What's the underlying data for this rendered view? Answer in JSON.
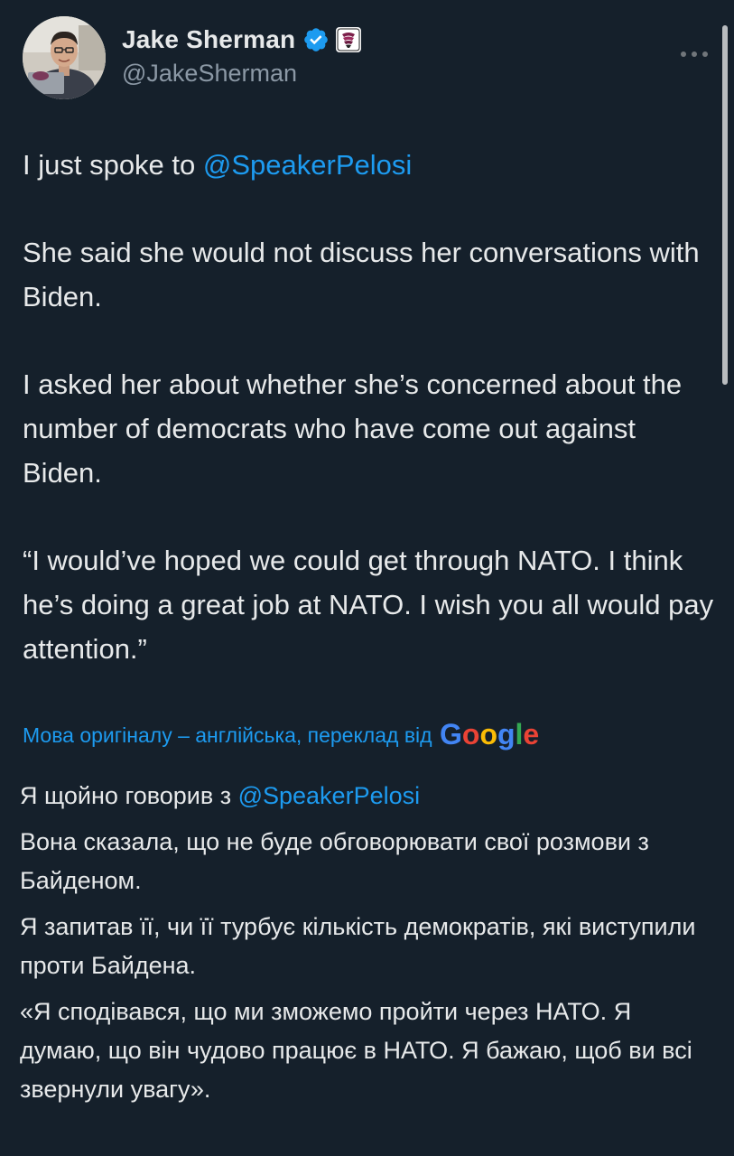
{
  "author": {
    "name": "Jake Sherman",
    "handle": "@JakeSherman"
  },
  "icons": {
    "verified": "verified-badge-icon",
    "affiliation": "affiliate-badge-icon",
    "more": "more-options-icon"
  },
  "colors": {
    "background": "#15202b",
    "text": "#e7e9ea",
    "secondary": "#8b98a5",
    "link": "#1d9bf0"
  },
  "tweet": {
    "p1_text": "I just spoke to ",
    "p1_mention": "@SpeakerPelosi",
    "p2": "She said she would not discuss her conversations with Biden.",
    "p3": "I asked her about whether she’s concerned about the number of democrats who have come out against Biden.",
    "p4": "“I would’ve hoped we could get through NATO. I think he’s doing a great job at NATO. I wish you all would pay attention.”"
  },
  "translation": {
    "note": "Мова оригіналу – англійська, переклад від",
    "provider": "Google",
    "p1_text": "Я щойно говорив з ",
    "p1_mention": "@SpeakerPelosi",
    "p2": "Вона сказала, що не буде обговорювати свої розмови з Байденом.",
    "p3": "Я запитав її, чи її турбує кількість демократів, які виступили проти Байдена.",
    "p4": "«Я сподівався, що ми зможемо пройти через НАТО. Я думаю, що він чудово працює в НАТО. Я бажаю, щоб ви всі звернули увагу»."
  }
}
